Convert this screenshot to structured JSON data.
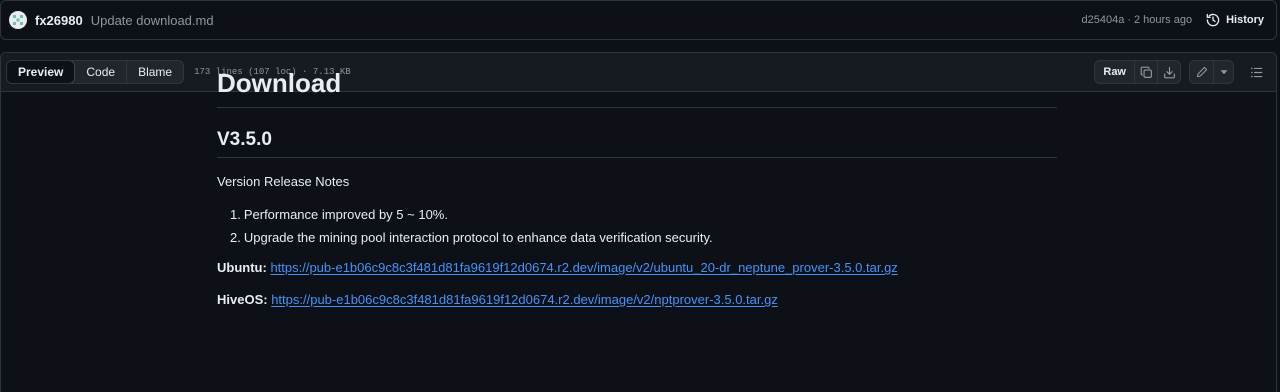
{
  "commit": {
    "author": "fx26980",
    "message": "Update download.md",
    "sha": "d25404a",
    "separator": "·",
    "time": "2 hours ago",
    "history_label": "History"
  },
  "file_header": {
    "tabs": [
      {
        "label": "Preview",
        "active": true
      },
      {
        "label": "Code",
        "active": false
      },
      {
        "label": "Blame",
        "active": false
      }
    ],
    "info": "173 lines (107 loc) · 7.13 KB",
    "raw_label": "Raw",
    "icons": [
      "copy-icon",
      "download-icon",
      "pencil-icon",
      "triangle-down-icon",
      "list-unordered-icon"
    ]
  },
  "content": {
    "h1": "Download",
    "h2": "V3.5.0",
    "notes_title": "Version Release Notes",
    "notes": [
      {
        "num": "1.",
        "text": "Performance improved by 5 ~ 10%."
      },
      {
        "num": "2.",
        "text": "Upgrade the mining pool interaction protocol to enhance data verification security."
      }
    ],
    "links": [
      {
        "label": "Ubuntu:",
        "url": "https://pub-e1b06c9c8c3f481d81fa9619f12d0674.r2.dev/image/v2/ubuntu_20-dr_neptune_prover-3.5.0.tar.gz"
      },
      {
        "label": "HiveOS:",
        "url": "https://pub-e1b06c9c8c3f481d81fa9619f12d0674.r2.dev/image/v2/nptprover-3.5.0.tar.gz"
      }
    ]
  },
  "colors": {
    "background": "#0d1117",
    "header_bg": "#161b22",
    "border": "#30363d",
    "text": "#e6edf3",
    "muted": "#8d96a0",
    "link": "#4493f8"
  }
}
